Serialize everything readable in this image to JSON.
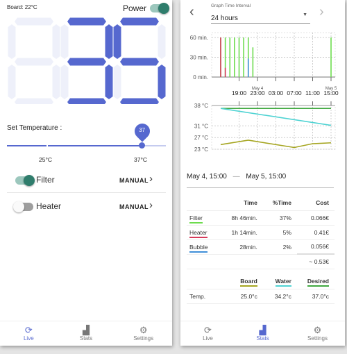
{
  "live": {
    "board_temp": "Board: 22°C",
    "power_label": "Power",
    "power_on": true,
    "display_digits": [
      "",
      "3",
      "5"
    ],
    "display_colors": {
      "on": "#5668cf",
      "off": "#eef0fa"
    },
    "set_temp_label": "Set Temperature :",
    "slider": {
      "value": "37",
      "value_num": 37,
      "min": 20,
      "max": 40,
      "mark_label": "25°C",
      "value_label": "37°C"
    },
    "rows": [
      {
        "label": "Filter",
        "on": true,
        "mode": "MANUAL"
      },
      {
        "label": "Heater",
        "on": false,
        "mode": "MANUAL"
      }
    ]
  },
  "nav": [
    {
      "label": "Live",
      "icon": "refresh-icon"
    },
    {
      "label": "Stats",
      "icon": "bar-chart-icon"
    },
    {
      "label": "Settings",
      "icon": "gear-icon"
    }
  ],
  "stats": {
    "interval_label": "Graph Time Interval",
    "interval_value": "24 hours",
    "range_start": "May 4, 15:00",
    "range_sep": "—",
    "range_end": "May 5, 15:00",
    "usage_headers": [
      "",
      "Time",
      "%Time",
      "Cost"
    ],
    "usage_rows": [
      {
        "name": "Filter",
        "color": "#6ddc4e",
        "time": "8h 46min.",
        "pct": "37%",
        "cost": "0.066€"
      },
      {
        "name": "Heater",
        "color": "#d63a5a",
        "time": "1h 14min.",
        "pct": "5%",
        "cost": "0.41€"
      },
      {
        "name": "Bubble",
        "color": "#3f8fd8",
        "time": "28min.",
        "pct": "2%",
        "cost": "0.056€"
      }
    ],
    "total_cost": "~ 0.53€",
    "temp_headers": [
      {
        "name": "Board",
        "color": "#a5a520"
      },
      {
        "name": "Water",
        "color": "#4fd3d3"
      },
      {
        "name": "Desired",
        "color": "#3fa83f"
      }
    ],
    "temp_row": {
      "label": "Temp.",
      "values": [
        "25.0°c",
        "34.2°c",
        "37.0°c"
      ]
    }
  },
  "chart_data": [
    {
      "type": "bar",
      "x_ticks": [
        "19:00",
        "23:00",
        "03:00",
        "07:00",
        "11:00",
        "15:00"
      ],
      "date_labels": [
        {
          "at": "23:00",
          "text": "May 4"
        },
        {
          "at": "15:00",
          "text": "May 5"
        }
      ],
      "y_ticks": [
        "0 min.",
        "30 min.",
        "60 min."
      ],
      "ylim": [
        0,
        60
      ],
      "grid": true,
      "series": [
        {
          "color": "#6ddc4e",
          "points": [
            [
              "May 4 15:00",
              60
            ],
            [
              "May 4 16:00",
              60
            ],
            [
              "May 4 17:00",
              60
            ],
            [
              "May 4 18:00",
              60
            ],
            [
              "May 4 19:00",
              60
            ],
            [
              "May 4 20:00",
              60
            ],
            [
              "May 4 21:00",
              60
            ],
            [
              "May 4 22:00",
              45
            ],
            [
              "May 5 15:00",
              60
            ]
          ]
        },
        {
          "color": "#d63a5a",
          "points": [
            [
              "May 4 15:00",
              60
            ],
            [
              "May 4 16:00",
              14
            ]
          ]
        },
        {
          "color": "#3f8fd8",
          "points": [
            [
              "May 4 21:00",
              28
            ]
          ]
        }
      ]
    },
    {
      "type": "line",
      "y_ticks": [
        "23 °C",
        "27 °C",
        "31 °C",
        "38 °C"
      ],
      "y_tick_values": [
        23,
        27,
        31,
        38
      ],
      "ylim": [
        23,
        38
      ],
      "grid": true,
      "series": [
        {
          "color": "#3fa83f",
          "points": [
            [
              "May 4 15:00",
              37
            ],
            [
              "May 5 15:00",
              37
            ]
          ]
        },
        {
          "color": "#4fd3d3",
          "points": [
            [
              "May 4 15:00",
              37
            ],
            [
              "May 5 15:00",
              31.2
            ]
          ]
        },
        {
          "color": "#a5a520",
          "points": [
            [
              "May 4 15:00",
              24.6
            ],
            [
              "May 4 21:00",
              26.1
            ],
            [
              "May 5 07:00",
              23.6
            ],
            [
              "May 5 11:00",
              24.9
            ],
            [
              "May 5 15:00",
              25.2
            ]
          ]
        }
      ]
    }
  ]
}
